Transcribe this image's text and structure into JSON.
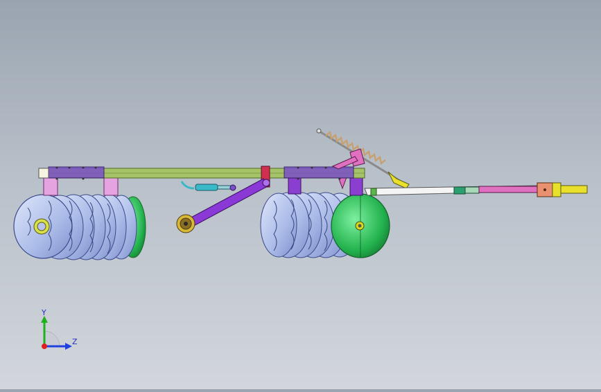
{
  "viewport": {
    "background_top": "#9aa4b0",
    "background_bottom": "#d2d6dc"
  },
  "model": {
    "colors": {
      "frame_beam": "#a7c36a",
      "frame_beam_dark": "#6f8f35",
      "plate": "#7b4fc9",
      "bracket_pink": "#e5a4e0",
      "bracket_purple": "#8a3fd0",
      "disc_blue": "#b7c6ee",
      "disc_edge": "#3a4a8a",
      "disc_green": "#2fbf5a",
      "link_purple": "#8a39d6",
      "cylinder_cyan": "#39b8c8",
      "spring_tan": "#c8a070",
      "hitch_yellow": "#e8e02a",
      "hitch_pink": "#e070c0",
      "hitch_teal": "#2aa070",
      "hub_yellow": "#d8d820",
      "red_bracket": "#d03050"
    },
    "parts": [
      "main-frame-beam",
      "rear-disc-gang",
      "front-disc-gang",
      "lift-link",
      "hydraulic-cylinder",
      "depth-spring",
      "drawbar",
      "hitch-clevis",
      "transport-wheel-hub"
    ]
  },
  "triad": {
    "y_label": "Y",
    "z_label": "Z",
    "y_color": "#20b020",
    "z_color": "#2040e0",
    "x_color": "#e02020"
  }
}
